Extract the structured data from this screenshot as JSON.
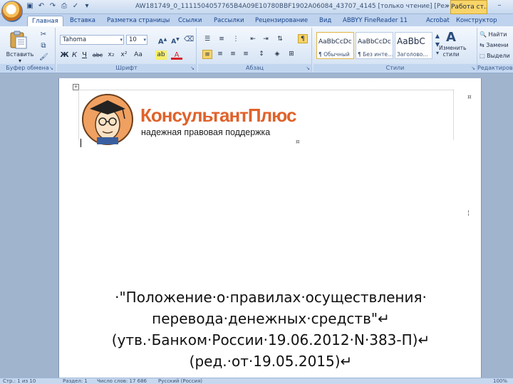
{
  "window": {
    "title": "AW181749_0_1111504057765B4A09E10780BBF1902A06084_43707_4145 [только чтение] [Режим огран...",
    "context_tab": "Работа ст...",
    "minimize_symbol": "–"
  },
  "quick_access": [
    "save-icon",
    "undo-icon",
    "redo-icon",
    "print-icon",
    "spellcheck-icon",
    "dropdown-icon"
  ],
  "ribbon_tabs": [
    {
      "label": "Главная",
      "active": true
    },
    {
      "label": "Вставка"
    },
    {
      "label": "Разметка страницы"
    },
    {
      "label": "Ссылки"
    },
    {
      "label": "Рассылки"
    },
    {
      "label": "Рецензирование"
    },
    {
      "label": "Вид"
    },
    {
      "label": "ABBYY FineReader 11"
    },
    {
      "label": "Acrobat"
    },
    {
      "label": "Конструктор"
    }
  ],
  "clipboard": {
    "paste_label": "Вставить",
    "paste_arrow": "▾",
    "group_label": "Буфер обмена"
  },
  "font": {
    "font_name": "Tahoma",
    "font_size": "10",
    "group_label": "Шрифт",
    "buttons": [
      "Ж",
      "К",
      "Ч",
      "abc",
      "x₂",
      "x²",
      "Aa",
      "ab",
      "A"
    ]
  },
  "paragraph": {
    "group_label": "Абзац",
    "pilcrow": "¶"
  },
  "styles": {
    "group_label": "Стили",
    "items": [
      {
        "sample": "AaBbCcDc",
        "name": "¶ Обычный"
      },
      {
        "sample": "AaBbCcDc",
        "name": "¶ Без инте..."
      },
      {
        "sample": "AaBbC",
        "name": "Заголово..."
      }
    ],
    "change_styles_label": "Изменить стили"
  },
  "editing": {
    "group_label": "Редактирова",
    "find": "Найти",
    "replace": "Замени",
    "select": "Выдели"
  },
  "document": {
    "logo_title": "КонсультантПлюс",
    "logo_subtitle": "надежная правовая поддержка",
    "lines": [
      "·\"Положение·о·правилах·осуществления·",
      "перевода·денежных·средств\"↵",
      "(утв.·Банком·России·19.06.2012·N·383-П)↵",
      "(ред.·от·19.05.2015)↵"
    ]
  },
  "status_bar": {
    "items": [
      "Стр.: 1 из 10",
      "Раздел: 1",
      "Число слов: 17 686",
      "Русский (Россия)"
    ],
    "zoom_label": "100%"
  }
}
